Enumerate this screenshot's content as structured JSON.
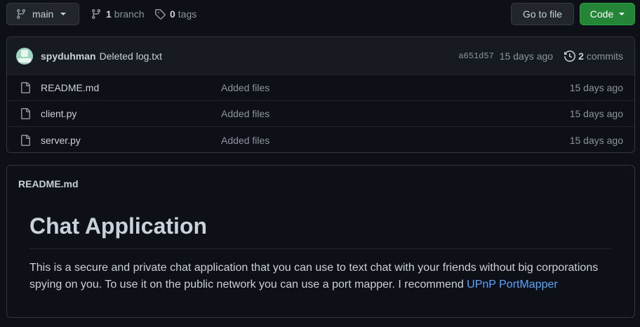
{
  "toolbar": {
    "branch_label": "main",
    "branch_count": "1",
    "branch_word": "branch",
    "tag_count": "0",
    "tag_word": "tags",
    "goto_label": "Go to file",
    "code_label": "Code"
  },
  "commit": {
    "author": "spyduhman",
    "message": "Deleted log.txt",
    "sha": "a651d57",
    "time": "15 days ago",
    "commits_count": "2",
    "commits_word": "commits"
  },
  "files": [
    {
      "name": "README.md",
      "message": "Added files",
      "time": "15 days ago"
    },
    {
      "name": "client.py",
      "message": "Added files",
      "time": "15 days ago"
    },
    {
      "name": "server.py",
      "message": "Added files",
      "time": "15 days ago"
    }
  ],
  "readme": {
    "filename": "README.md",
    "title": "Chat Application",
    "body": "This is a secure and private chat application that you can use to text chat with your friends without big corporations spying on you. To use it on the public network you can use a port mapper. I recommend ",
    "link_text": "UPnP PortMapper"
  },
  "colors": {
    "background": "#0d1117",
    "code_button": "#238636",
    "link": "#58a6ff"
  }
}
